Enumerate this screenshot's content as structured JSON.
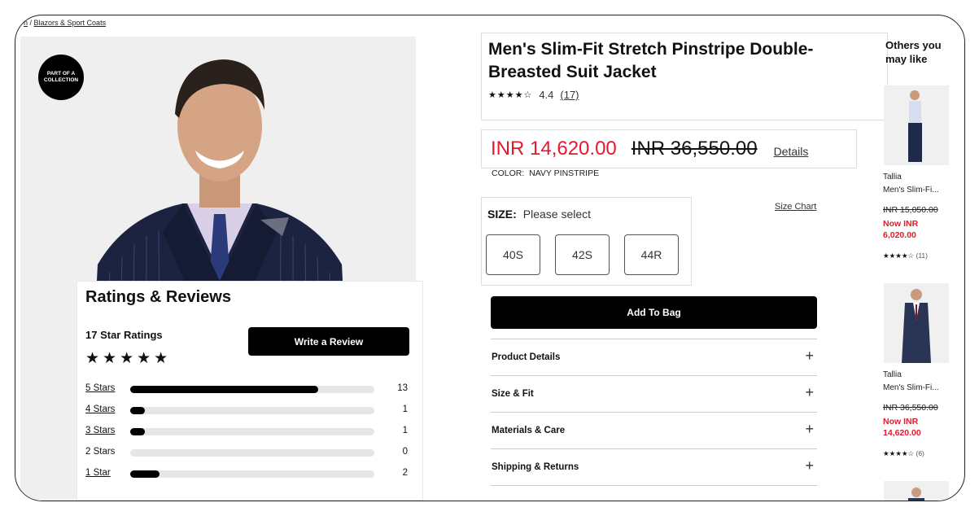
{
  "breadcrumb": {
    "partial": "n",
    "current": "Blazors & Sport Coats"
  },
  "badge": {
    "line1": "PART OF A",
    "line2": "COLLECTION"
  },
  "product": {
    "title": "Men's Slim-Fit Stretch Pinstripe Double-Breasted Suit Jacket",
    "stars": "★★★★☆",
    "rating": "4.4",
    "review_count": "(17)",
    "price_now": "INR 14,620.00",
    "price_was": "INR 36,550.00",
    "details_label": "Details",
    "color_label": "COLOR:",
    "color_value": "NAVY PINSTRIPE",
    "size_label": "SIZE:",
    "size_placeholder": "Please select",
    "sizes": [
      "40S",
      "42S",
      "44R"
    ],
    "size_chart": "Size Chart",
    "add_to_bag": "Add To Bag",
    "accordions": [
      "Product Details",
      "Size & Fit",
      "Materials & Care",
      "Shipping & Returns"
    ]
  },
  "ratings": {
    "heading": "Ratings & Reviews",
    "total_label": "17 Star Ratings",
    "big_stars": "★★★★★",
    "write_review": "Write a Review",
    "total": 17,
    "bars": [
      {
        "label": "5 Stars",
        "count": 13,
        "fraction": 0.77,
        "link": true
      },
      {
        "label": "4 Stars",
        "count": 1,
        "fraction": 0.06,
        "link": true
      },
      {
        "label": "3 Stars",
        "count": 1,
        "fraction": 0.06,
        "link": true
      },
      {
        "label": "2 Stars",
        "count": 0,
        "fraction": 0,
        "link": false
      },
      {
        "label": "1 Star",
        "count": 2,
        "fraction": 0.12,
        "link": true
      }
    ]
  },
  "others": {
    "heading_line1": "Others you",
    "heading_line2": "may like",
    "items": [
      {
        "brand": "Tallia",
        "name": "Men's Slim-Fi...",
        "was": "INR 15,050.00",
        "now_line1": "Now INR",
        "now_line2": "6,020.00",
        "stars": "★★★★☆",
        "count": "(11)"
      },
      {
        "brand": "Tallia",
        "name": "Men's Slim-Fi...",
        "was": "INR 36,550.00",
        "now_line1": "Now INR",
        "now_line2": "14,620.00",
        "stars": "★★★★☆",
        "count": "(6)"
      }
    ]
  },
  "colors": {
    "sale_red": "#e21a2c",
    "black": "#000000",
    "suit_navy": "#1c2340"
  }
}
